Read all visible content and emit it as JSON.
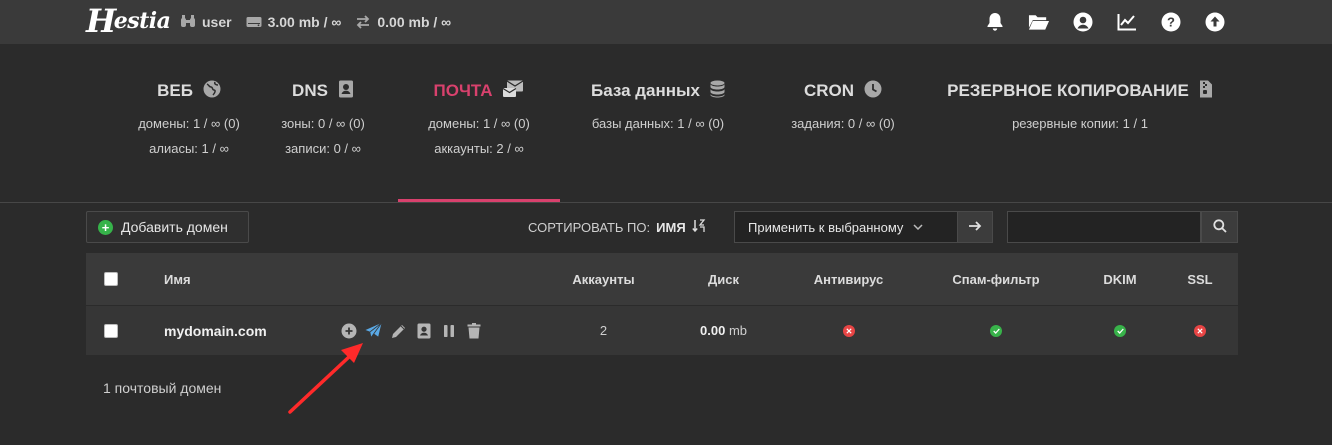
{
  "header": {
    "logo_text": "estia",
    "logo_initial": "H",
    "user": "user",
    "disk_usage": "3.00 mb / ∞",
    "bandwidth": "0.00 mb / ∞",
    "icons": [
      "bell-icon",
      "folder-open-icon",
      "user-circle-icon",
      "chart-line-icon",
      "question-circle-icon",
      "arrow-up-circle-icon"
    ]
  },
  "tabs": [
    {
      "label": "ВЕБ",
      "icon": "globe-icon",
      "line1": "домены: 1 / ∞ (0)",
      "line2": "алиасы: 1 / ∞"
    },
    {
      "label": "DNS",
      "icon": "address-book-icon",
      "line1": "зоны: 0 / ∞ (0)",
      "line2": "записи: 0 / ∞"
    },
    {
      "label": "ПОЧТА",
      "icon": "mail-bulk-icon",
      "line1": "домены: 1 / ∞ (0)",
      "line2": "аккаунты: 2 / ∞",
      "active": true
    },
    {
      "label": "База данных",
      "icon": "database-icon",
      "line1": "базы данных: 1 / ∞ (0)",
      "line2": ""
    },
    {
      "label": "CRON",
      "icon": "clock-icon",
      "line1": "задания: 0 / ∞ (0)",
      "line2": ""
    },
    {
      "label": "РЕЗЕРВНОЕ КОПИРОВАНИЕ",
      "icon": "file-archive-icon",
      "line1": "резервные копии: 1 / 1",
      "line2": ""
    }
  ],
  "toolbar": {
    "add_domain_label": "Добавить домен",
    "sort_label": "СОРТИРОВАТЬ ПО:",
    "sort_value": "ИМЯ",
    "bulk_select_value": "Применить к выбранному",
    "search_placeholder": ""
  },
  "table": {
    "columns": [
      "Имя",
      "Аккаунты",
      "Диск",
      "Антивирус",
      "Спам-фильтр",
      "DKIM",
      "SSL"
    ],
    "rows": [
      {
        "name": "mydomain.com",
        "accounts": "2",
        "disk_value": "0.00",
        "disk_unit": "mb",
        "antivirus": "off",
        "spam_filter": "on",
        "dkim": "on",
        "ssl": "off",
        "actions": [
          "add-account-icon",
          "send-icon",
          "edit-pencil-icon",
          "address-book-icon",
          "pause-icon",
          "trash-icon"
        ]
      }
    ]
  },
  "footer": {
    "count_text": "1 почтовый домен"
  },
  "colors": {
    "accent": "#d8416d",
    "status_on": "#38b34a",
    "status_off": "#e84545",
    "action_send": "#5aa9e6"
  }
}
